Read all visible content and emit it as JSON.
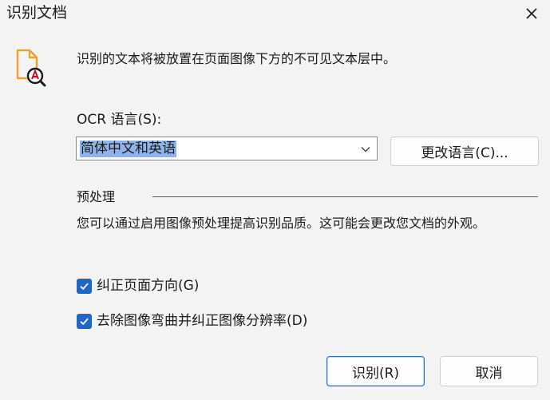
{
  "window": {
    "title": "识别文档"
  },
  "info": {
    "text": "识别的文本将被放置在页面图像下方的不可见文本层中。"
  },
  "ocr": {
    "label": "OCR 语言(S):",
    "selected_language": "简体中文和英语",
    "change_button": "更改语言(C)..."
  },
  "preprocessing": {
    "title": "预处理",
    "description": "您可以通过启用图像预处理提高识别品质。这可能会更改您文档的外观。",
    "options": [
      {
        "label": "纠正页面方向(G)",
        "checked": true
      },
      {
        "label": "去除图像弯曲并纠正图像分辨率(D)",
        "checked": true
      }
    ]
  },
  "buttons": {
    "recognize": "识别(R)",
    "cancel": "取消"
  },
  "colors": {
    "accent": "#1e67c6",
    "icon_orange": "#f0a030",
    "selection": "#90b4e8"
  },
  "icons": {
    "close": "close-icon",
    "document": "document-ocr-icon",
    "dropdown": "chevron-down-icon",
    "check": "checkmark-icon"
  }
}
